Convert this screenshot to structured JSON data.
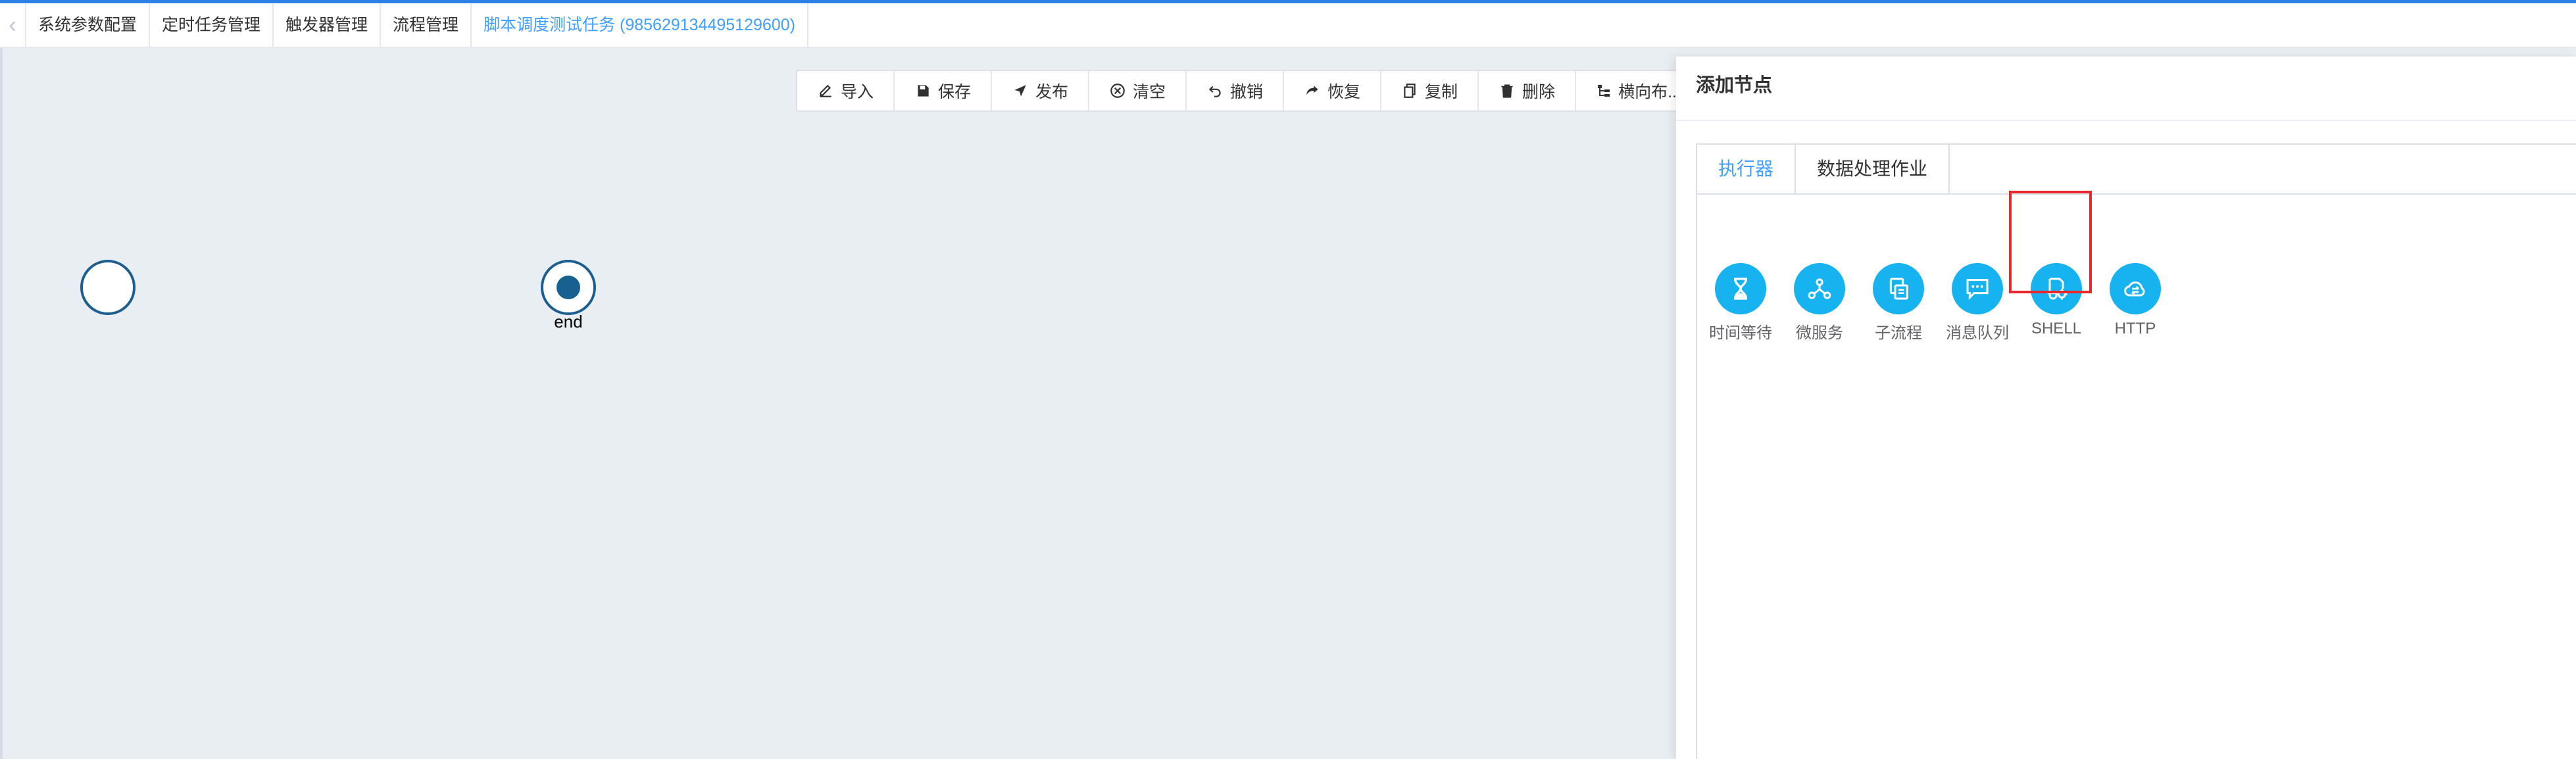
{
  "tabs": [
    {
      "label": "系统参数配置",
      "active": false
    },
    {
      "label": "定时任务管理",
      "active": false
    },
    {
      "label": "触发器管理",
      "active": false
    },
    {
      "label": "流程管理",
      "active": false
    },
    {
      "label": "脚本调度测试任务 (985629134495129600)",
      "active": true
    }
  ],
  "toolbar": {
    "import": "导入",
    "save": "保存",
    "publish": "发布",
    "clear": "清空",
    "undo": "撤销",
    "redo": "恢复",
    "copy": "复制",
    "delete": "删除",
    "horizontal_layout": "横向布..."
  },
  "canvas": {
    "end_label": "end"
  },
  "panel": {
    "title": "添加节点",
    "tabs": [
      {
        "label": "执行器",
        "active": true
      },
      {
        "label": "数据处理作业",
        "active": false
      }
    ],
    "nodes": [
      {
        "label": "时间等待",
        "icon": "hourglass-icon"
      },
      {
        "label": "微服务",
        "icon": "microservice-icon"
      },
      {
        "label": "子流程",
        "icon": "subprocess-icon"
      },
      {
        "label": "消息队列",
        "icon": "message-queue-icon"
      },
      {
        "label": "SHELL",
        "icon": "shell-icon"
      },
      {
        "label": "HTTP",
        "icon": "http-icon"
      }
    ]
  },
  "colors": {
    "accent": "#409eff",
    "node_icon_bg": "#16b3f0",
    "flow_node_border": "#1b5e8f",
    "highlight": "#e8262d"
  }
}
